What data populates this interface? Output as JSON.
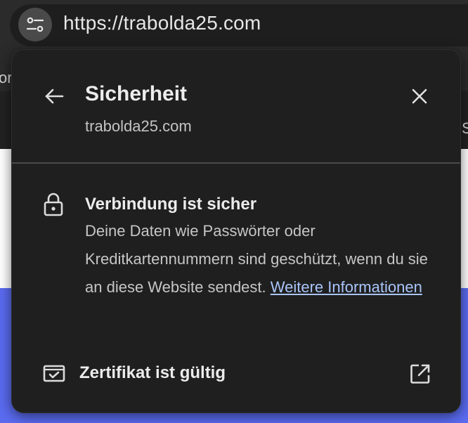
{
  "browser": {
    "url": "https://trabolda25.com",
    "background_fragments": {
      "left_text": "or",
      "right_text": "S"
    }
  },
  "popup": {
    "title": "Sicherheit",
    "subtitle": "trabolda25.com",
    "connection": {
      "heading": "Verbindung ist sicher",
      "body": "Deine Daten wie Passwörter oder Kreditkartennummern sind geschützt, wenn du sie an diese Website sendest.",
      "link_label": "Weitere Informationen"
    },
    "certificate": {
      "label": "Zertifikat ist gültig"
    }
  },
  "icons": {
    "site_settings": "tune-icon",
    "back": "arrow-back-icon",
    "close": "close-icon",
    "lock": "lock-icon",
    "certificate": "certificate-check-icon",
    "external": "open-in-new-icon"
  },
  "colors": {
    "popup_bg": "#1f1f1f",
    "link": "#a9c5fa",
    "text_primary": "#ececec",
    "text_secondary": "#c6c6c6",
    "page_accent_blue": "#5a6bf0"
  }
}
